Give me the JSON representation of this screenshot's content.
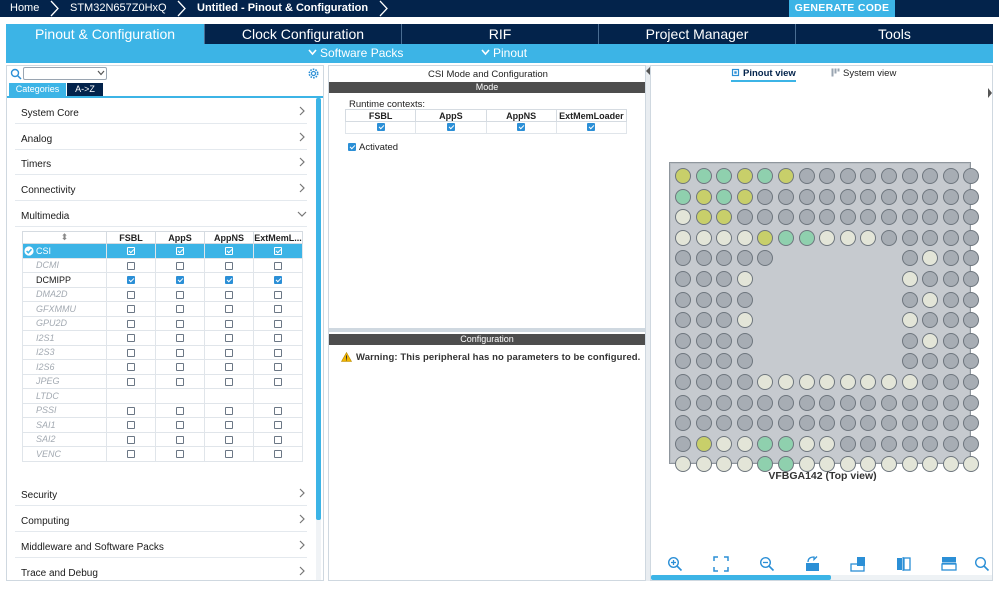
{
  "breadcrumb": {
    "home": "Home",
    "device": "STM32N657Z0HxQ",
    "project": "Untitled - Pinout & Configuration"
  },
  "generate_button": "GENERATE CODE",
  "main_tabs": [
    {
      "label": "Pinout & Configuration",
      "active": true
    },
    {
      "label": "Clock Configuration",
      "active": false
    },
    {
      "label": "RIF",
      "active": false
    },
    {
      "label": "Project Manager",
      "active": false
    },
    {
      "label": "Tools",
      "active": false
    }
  ],
  "sub_menu": {
    "software_packs": "Software Packs",
    "pinout": "Pinout"
  },
  "left_panel": {
    "search_value": "",
    "tab_categories": "Categories",
    "tab_atoz": "A->Z",
    "categories_top": [
      "System Core",
      "Analog",
      "Timers",
      "Connectivity",
      "Multimedia"
    ],
    "categories_bottom": [
      "Security",
      "Computing",
      "Middleware and Software Packs",
      "Trace and Debug"
    ],
    "table_headers": [
      "FSBL",
      "AppS",
      "AppNS",
      "ExtMemL..."
    ],
    "sort_glyph": "⬍",
    "peripherals": [
      {
        "name": "CSI",
        "state": "selected",
        "checks": [
          true,
          true,
          true,
          true
        ]
      },
      {
        "name": "DCMI",
        "state": "disabled",
        "checks": [
          false,
          false,
          false,
          false
        ]
      },
      {
        "name": "DCMIPP",
        "state": "normal",
        "checks": [
          true,
          true,
          true,
          true
        ]
      },
      {
        "name": "DMA2D",
        "state": "disabled",
        "checks": [
          false,
          false,
          false,
          false
        ]
      },
      {
        "name": "GFXMMU",
        "state": "disabled",
        "checks": [
          false,
          false,
          false,
          false
        ]
      },
      {
        "name": "GPU2D",
        "state": "disabled",
        "checks": [
          false,
          false,
          false,
          false
        ]
      },
      {
        "name": "I2S1",
        "state": "disabled",
        "checks": [
          false,
          false,
          false,
          false
        ]
      },
      {
        "name": "I2S3",
        "state": "disabled",
        "checks": [
          false,
          false,
          false,
          false
        ]
      },
      {
        "name": "I2S6",
        "state": "disabled",
        "checks": [
          false,
          false,
          false,
          false
        ]
      },
      {
        "name": "JPEG",
        "state": "disabled",
        "checks": [
          false,
          false,
          false,
          false
        ]
      },
      {
        "name": "LTDC",
        "state": "disabled-nocb",
        "checks": [
          false,
          false,
          false,
          false
        ]
      },
      {
        "name": "PSSI",
        "state": "disabled",
        "checks": [
          false,
          false,
          false,
          false
        ]
      },
      {
        "name": "SAI1",
        "state": "disabled",
        "checks": [
          false,
          false,
          false,
          false
        ]
      },
      {
        "name": "SAI2",
        "state": "disabled",
        "checks": [
          false,
          false,
          false,
          false
        ]
      },
      {
        "name": "VENC",
        "state": "disabled",
        "checks": [
          false,
          false,
          false,
          false
        ]
      }
    ]
  },
  "mode_panel": {
    "title": "CSI Mode and Configuration",
    "mode_header": "Mode",
    "runtime_label": "Runtime contexts:",
    "contexts": [
      {
        "name": "FSBL",
        "checked": true
      },
      {
        "name": "AppS",
        "checked": true
      },
      {
        "name": "AppNS",
        "checked": true
      },
      {
        "name": "ExtMemLoader",
        "checked": true
      }
    ],
    "activated_label": "Activated",
    "activated_checked": true,
    "config_header": "Configuration",
    "warning": "Warning: This peripheral has no parameters to be configured."
  },
  "pinout_panel": {
    "tab_pinout": "Pinout view",
    "tab_system": "System view",
    "chip_label": "VFBGA142 (Top view)",
    "colors": {
      "pin_default": "#a7adb4",
      "pin_assigned": "#c8cf6a",
      "pin_green": "#8fd0ae",
      "pin_power": "#e3e5d8",
      "accent": "#3cb4e6",
      "navy": "#03234b"
    },
    "toolbar_icons": [
      "zoom-in-icon",
      "fit-screen-icon",
      "zoom-out-icon",
      "rotate-icon",
      "flip-icon",
      "split-vertical-icon",
      "split-horizontal-icon",
      "search-icon"
    ]
  }
}
